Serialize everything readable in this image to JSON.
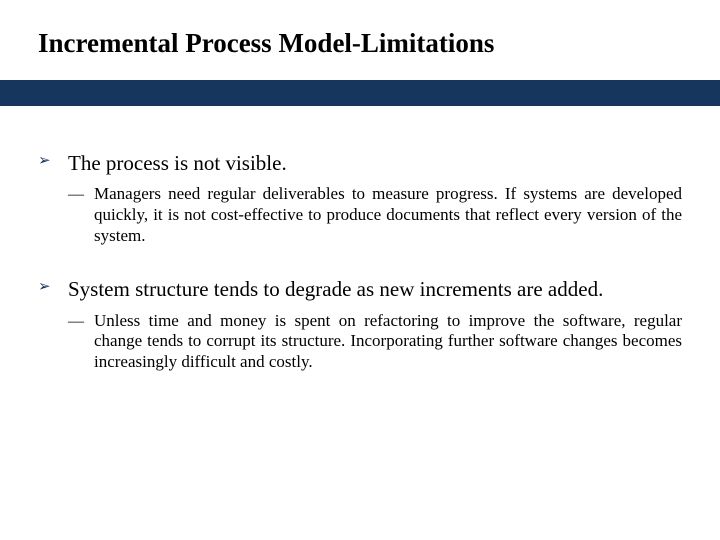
{
  "title": "Incremental Process Model-Limitations",
  "points": [
    {
      "heading": "The process is not visible.",
      "sub": "Managers need regular deliverables to measure progress. If systems are developed quickly, it is not cost-effective to produce documents that reflect every version of the system."
    },
    {
      "heading": "System structure tends to degrade as new increments are added.",
      "sub": "Unless time and money is spent on refactoring to improve the software, regular change tends to corrupt its structure. Incorporating further software changes becomes increasingly difficult and costly."
    }
  ]
}
